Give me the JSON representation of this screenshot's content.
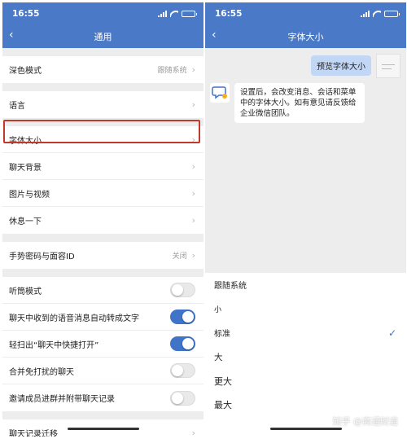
{
  "left": {
    "status": {
      "time": "16:55"
    },
    "nav": {
      "title": "通用",
      "back": "‹"
    },
    "groups": [
      {
        "rows": [
          {
            "label": "深色模式",
            "value": "跟随系统"
          }
        ]
      },
      {
        "rows": [
          {
            "label": "语言"
          }
        ]
      },
      {
        "rows": [
          {
            "label": "字体大小"
          },
          {
            "label": "聊天背景"
          },
          {
            "label": "图片与视频"
          },
          {
            "label": "休息一下"
          }
        ]
      },
      {
        "rows": [
          {
            "label": "手势密码与面容ID",
            "value": "关闭"
          }
        ]
      },
      {
        "rows": [
          {
            "label": "听筒模式",
            "toggle": false
          },
          {
            "label": "聊天中收到的语音消息自动转成文字",
            "toggle": true
          },
          {
            "label": "轻扫出“聊天中快捷打开”",
            "toggle": true
          },
          {
            "label": "合并免打扰的聊天",
            "toggle": false
          },
          {
            "label": "邀请成员进群并附带聊天记录",
            "toggle": false
          }
        ]
      },
      {
        "rows": [
          {
            "label": "聊天记录迁移"
          }
        ]
      }
    ]
  },
  "right": {
    "status": {
      "time": "16:55"
    },
    "nav": {
      "title": "字体大小",
      "back": "‹"
    },
    "preview_bubble": "预览字体大小",
    "info_bubble": "设置后，会改变消息、会话和菜单中的字体大小。如有意见请反馈给企业微信团队。",
    "options": [
      "跟随系统",
      "小",
      "标准",
      "大",
      "更大",
      "最大"
    ],
    "selected_option": "标准"
  },
  "watermark": "知乎 @商通财道",
  "colors": {
    "accent": "#4a79c7",
    "toggle_on": "#3f74c9",
    "highlight": "#c0392b"
  }
}
